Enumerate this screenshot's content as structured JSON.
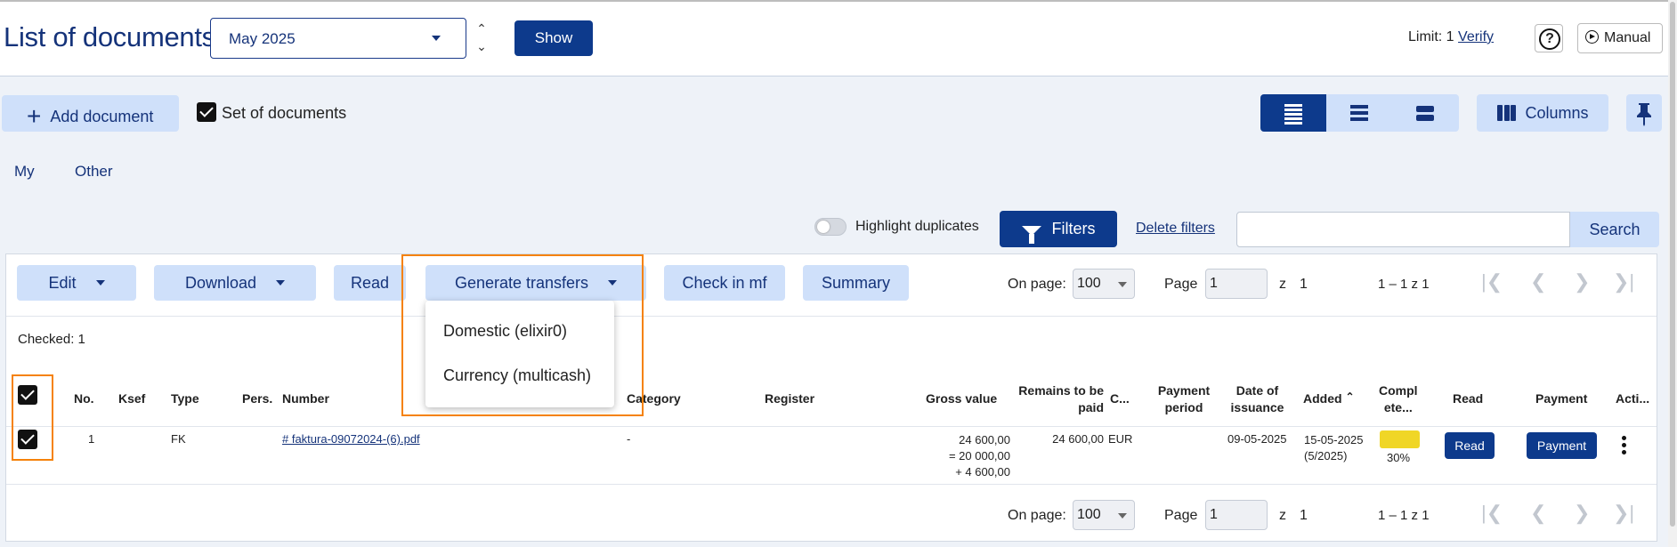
{
  "header": {
    "title": "List of documents",
    "month": "May 2025",
    "show_label": "Show",
    "limit_label": "Limit: 1",
    "verify_label": "Verify",
    "help_glyph": "?",
    "manual_label": "Manual"
  },
  "actions": {
    "add_document": "Add document",
    "set_of_documents": "Set of documents",
    "columns": "Columns"
  },
  "tabs": [
    {
      "label": "My",
      "active": true
    },
    {
      "label": "Other",
      "active": false
    }
  ],
  "filters": {
    "highlight_duplicates": "Highlight duplicates",
    "filters_label": "Filters",
    "delete_filters": "Delete filters",
    "search_value": "",
    "search_label": "Search"
  },
  "toolbar": {
    "edit": "Edit",
    "download": "Download",
    "read": "Read",
    "generate_transfers": "Generate transfers",
    "check_in_mf": "Check in mf",
    "summary": "Summary"
  },
  "dropdown": {
    "items": [
      "Domestic (elixir0)",
      "Currency (multicash)"
    ]
  },
  "pagination": {
    "on_page_label": "On page:",
    "on_page_value": "100",
    "page_label": "Page",
    "page_value": "1",
    "of_label": "z",
    "total_pages": "1",
    "range_text": "1 – 1 z 1"
  },
  "checked_text": "Checked: 1",
  "table": {
    "columns": {
      "no": "No.",
      "ksef": "Ksef",
      "type": "Type",
      "pers": "Pers.",
      "number": "Number",
      "category": "Category",
      "register": "Register",
      "gross_value": "Gross value",
      "remains_1": "Remains to be",
      "remains_2": "paid",
      "currency": "C...",
      "payment_period_1": "Payment",
      "payment_period_2": "period",
      "date_issuance_1": "Date of",
      "date_issuance_2": "issuance",
      "added": "Added",
      "complete_1": "Compl",
      "complete_2": "ete...",
      "read": "Read",
      "payment": "Payment",
      "actions": "Acti..."
    },
    "rows": [
      {
        "no": "1",
        "type": "FK",
        "number": "# faktura-09072024-(6).pdf",
        "category": "-",
        "gross_1": "24 600,00",
        "gross_2": "= 20 000,00",
        "gross_3": "+ 4 600,00",
        "remains": "24 600,00",
        "currency": "EUR",
        "date_issuance": "09-05-2025",
        "added_1": "15-05-2025",
        "added_2": "(5/2025)",
        "complete_pct": 30,
        "complete_label": "30%",
        "read_btn": "Read",
        "payment_btn": "Payment"
      }
    ]
  },
  "colors": {
    "primary": "#0d3a8c",
    "light_button": "#cfe0fa",
    "highlight": "#f5820a",
    "progress": "#f0d626"
  }
}
